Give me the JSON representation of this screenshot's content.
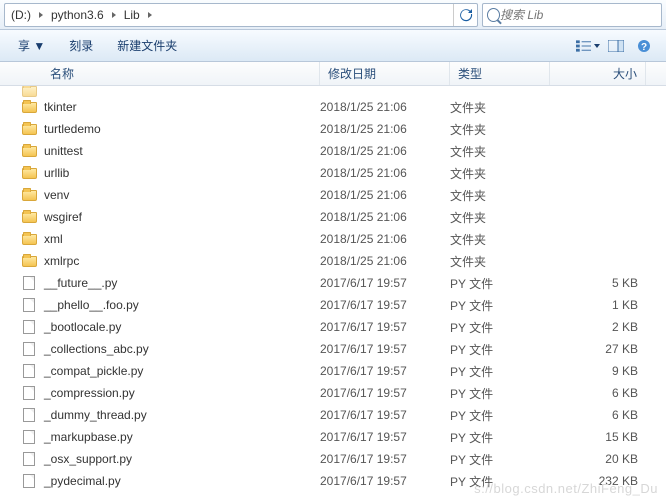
{
  "breadcrumb": {
    "drive": "(D:)",
    "seg1": "python3.6",
    "seg2": "Lib"
  },
  "search": {
    "placeholder": "搜索 Lib"
  },
  "toolbar": {
    "share": "享 ▼",
    "burn": "刻录",
    "newfolder": "新建文件夹"
  },
  "columns": {
    "name": "名称",
    "date": "修改日期",
    "type": "类型",
    "size": "大小"
  },
  "files": [
    {
      "name": "tkinter",
      "date": "2018/1/25 21:06",
      "type": "文件夹",
      "size": "",
      "kind": "folder"
    },
    {
      "name": "turtledemo",
      "date": "2018/1/25 21:06",
      "type": "文件夹",
      "size": "",
      "kind": "folder"
    },
    {
      "name": "unittest",
      "date": "2018/1/25 21:06",
      "type": "文件夹",
      "size": "",
      "kind": "folder"
    },
    {
      "name": "urllib",
      "date": "2018/1/25 21:06",
      "type": "文件夹",
      "size": "",
      "kind": "folder"
    },
    {
      "name": "venv",
      "date": "2018/1/25 21:06",
      "type": "文件夹",
      "size": "",
      "kind": "folder"
    },
    {
      "name": "wsgiref",
      "date": "2018/1/25 21:06",
      "type": "文件夹",
      "size": "",
      "kind": "folder"
    },
    {
      "name": "xml",
      "date": "2018/1/25 21:06",
      "type": "文件夹",
      "size": "",
      "kind": "folder"
    },
    {
      "name": "xmlrpc",
      "date": "2018/1/25 21:06",
      "type": "文件夹",
      "size": "",
      "kind": "folder"
    },
    {
      "name": "__future__.py",
      "date": "2017/6/17 19:57",
      "type": "PY 文件",
      "size": "5 KB",
      "kind": "file"
    },
    {
      "name": "__phello__.foo.py",
      "date": "2017/6/17 19:57",
      "type": "PY 文件",
      "size": "1 KB",
      "kind": "file"
    },
    {
      "name": "_bootlocale.py",
      "date": "2017/6/17 19:57",
      "type": "PY 文件",
      "size": "2 KB",
      "kind": "file"
    },
    {
      "name": "_collections_abc.py",
      "date": "2017/6/17 19:57",
      "type": "PY 文件",
      "size": "27 KB",
      "kind": "file"
    },
    {
      "name": "_compat_pickle.py",
      "date": "2017/6/17 19:57",
      "type": "PY 文件",
      "size": "9 KB",
      "kind": "file"
    },
    {
      "name": "_compression.py",
      "date": "2017/6/17 19:57",
      "type": "PY 文件",
      "size": "6 KB",
      "kind": "file"
    },
    {
      "name": "_dummy_thread.py",
      "date": "2017/6/17 19:57",
      "type": "PY 文件",
      "size": "6 KB",
      "kind": "file"
    },
    {
      "name": "_markupbase.py",
      "date": "2017/6/17 19:57",
      "type": "PY 文件",
      "size": "15 KB",
      "kind": "file"
    },
    {
      "name": "_osx_support.py",
      "date": "2017/6/17 19:57",
      "type": "PY 文件",
      "size": "20 KB",
      "kind": "file"
    },
    {
      "name": "_pydecimal.py",
      "date": "2017/6/17 19:57",
      "type": "PY 文件",
      "size": "232 KB",
      "kind": "file"
    }
  ],
  "watermark": "s://blog.csdn.net/ZhiFeng_Du"
}
